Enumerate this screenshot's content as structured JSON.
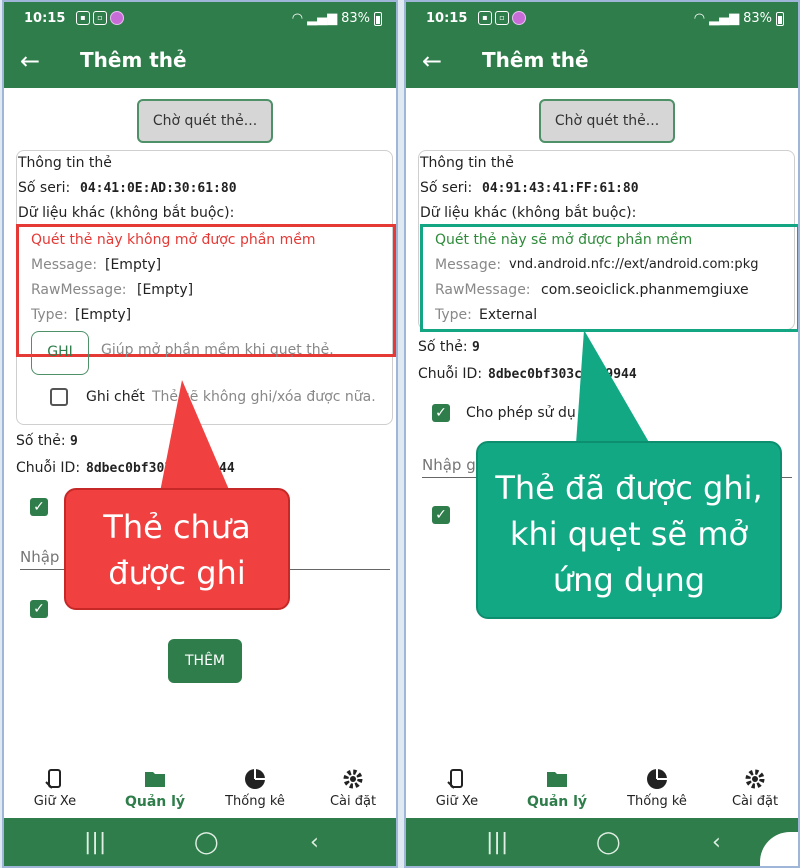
{
  "status": {
    "time": "10:15",
    "battery": "83%"
  },
  "appbar": {
    "title": "Thêm thẻ"
  },
  "scan_button": "Chờ quét thẻ...",
  "card": {
    "heading": "Thông tin thẻ",
    "serial_label": "Số seri:",
    "other_label": "Dữ liệu khác (không bắt buộc):",
    "message_label": "Message:",
    "rawmessage_label": "RawMessage:",
    "type_label": "Type:"
  },
  "left": {
    "serial": "04:41:0E:AD:30:61:80",
    "warning": "Quét thẻ này không mở được phần mềm",
    "message": "[Empty]",
    "rawmessage": "[Empty]",
    "type": "[Empty]",
    "write_button": "GHI",
    "write_hint": "Giúp mở phần mềm khi quẹt thẻ.",
    "lock_label": "Ghi chết",
    "lock_hint": "Thẻ sẽ không ghi/xóa được nữa.",
    "card_no_label": "Số thẻ:",
    "card_no": "9",
    "chain_label": "Chuỗi ID:",
    "chain": "8dbec0bf303c66c9944",
    "input_placeholder": "Nhập g",
    "add_button": "THÊM",
    "callout": "Thẻ chưa được ghi"
  },
  "right": {
    "serial": "04:91:43:41:FF:61:80",
    "notice": "Quét thẻ này sẽ mở được phần mềm",
    "message": "vnd.android.nfc://ext/android.com:pkg",
    "rawmessage": "com.seoiclick.phanmemgiuxe",
    "type": "External",
    "card_no_label": "Số thẻ:",
    "card_no": "9",
    "chain_label": "Chuỗi ID:",
    "chain": "8dbec0bf303c66c9944",
    "allow_label": "Cho phép sử dụ",
    "input_placeholder": "Nhập g",
    "callout": "Thẻ đã được ghi, khi quẹt sẽ mở ứng dụng"
  },
  "nav": [
    "Giữ Xe",
    "Quản lý",
    "Thống kê",
    "Cài đặt"
  ],
  "colors": {
    "primary": "#2e7d4a",
    "warning_red": "#e53935",
    "teal": "#13a884"
  }
}
